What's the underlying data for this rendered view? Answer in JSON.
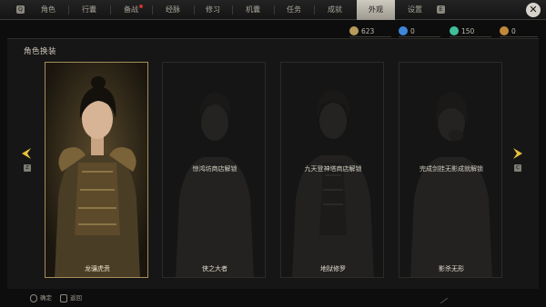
{
  "nav": {
    "left_key": "Q",
    "right_key": "E",
    "tabs": [
      {
        "label": "角色",
        "active": false,
        "badge": false
      },
      {
        "label": "行囊",
        "active": false,
        "badge": false
      },
      {
        "label": "备战",
        "active": false,
        "badge": true
      },
      {
        "label": "经脉",
        "active": false,
        "badge": false
      },
      {
        "label": "修习",
        "active": false,
        "badge": false
      },
      {
        "label": "机囊",
        "active": false,
        "badge": false
      },
      {
        "label": "任务",
        "active": false,
        "badge": false
      },
      {
        "label": "成就",
        "active": false,
        "badge": false
      },
      {
        "label": "外观",
        "active": true,
        "badge": false
      },
      {
        "label": "设置",
        "active": false,
        "badge": false
      }
    ],
    "close_icon": "close-x-icon"
  },
  "panel": {
    "title": "角色换装"
  },
  "currencies": [
    {
      "icon": "coin-icon",
      "value": "623",
      "color": "#b89a5a"
    },
    {
      "icon": "flame-icon",
      "value": "0",
      "color": "#3f86d8"
    },
    {
      "icon": "jade-icon",
      "value": "150",
      "color": "#3fbf9a"
    },
    {
      "icon": "token-icon",
      "value": "0",
      "color": "#c08a3a"
    }
  ],
  "outfits": [
    {
      "name": "龙骧虎贲",
      "unlocked": true,
      "selected": true,
      "lock_text": ""
    },
    {
      "name": "侠之大者",
      "unlocked": false,
      "selected": false,
      "lock_text": "惊鸿坊商店解锁"
    },
    {
      "name": "地狱修罗",
      "unlocked": false,
      "selected": false,
      "lock_text": "九天登神塔商店解锁"
    },
    {
      "name": "影杀无形",
      "unlocked": false,
      "selected": false,
      "lock_text": "完成剑挂无影成就解锁"
    }
  ],
  "arrows": {
    "left_key": "Z",
    "right_key": "C",
    "left_icon": "arrow-left-icon",
    "right_icon": "arrow-right-icon"
  },
  "footer": {
    "confirm_label": "确定",
    "back_label": "返回",
    "confirm_icon": "mouse-icon",
    "back_icon": "escape-key-icon"
  },
  "colors": {
    "accent_gold": "#e6c13c",
    "active_tab": "#c6c1b6",
    "selected_frame": "#a58d5a"
  }
}
